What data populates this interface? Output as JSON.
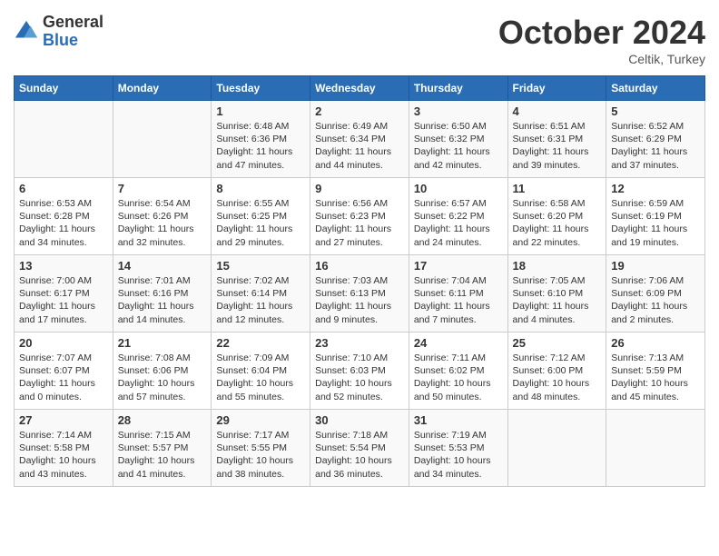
{
  "header": {
    "logo_general": "General",
    "logo_blue": "Blue",
    "month_title": "October 2024",
    "location": "Celtik, Turkey"
  },
  "weekdays": [
    "Sunday",
    "Monday",
    "Tuesday",
    "Wednesday",
    "Thursday",
    "Friday",
    "Saturday"
  ],
  "weeks": [
    [
      null,
      null,
      {
        "day": 1,
        "sunrise": "6:48 AM",
        "sunset": "6:36 PM",
        "daylight": "11 hours and 47 minutes."
      },
      {
        "day": 2,
        "sunrise": "6:49 AM",
        "sunset": "6:34 PM",
        "daylight": "11 hours and 44 minutes."
      },
      {
        "day": 3,
        "sunrise": "6:50 AM",
        "sunset": "6:32 PM",
        "daylight": "11 hours and 42 minutes."
      },
      {
        "day": 4,
        "sunrise": "6:51 AM",
        "sunset": "6:31 PM",
        "daylight": "11 hours and 39 minutes."
      },
      {
        "day": 5,
        "sunrise": "6:52 AM",
        "sunset": "6:29 PM",
        "daylight": "11 hours and 37 minutes."
      }
    ],
    [
      {
        "day": 6,
        "sunrise": "6:53 AM",
        "sunset": "6:28 PM",
        "daylight": "11 hours and 34 minutes."
      },
      {
        "day": 7,
        "sunrise": "6:54 AM",
        "sunset": "6:26 PM",
        "daylight": "11 hours and 32 minutes."
      },
      {
        "day": 8,
        "sunrise": "6:55 AM",
        "sunset": "6:25 PM",
        "daylight": "11 hours and 29 minutes."
      },
      {
        "day": 9,
        "sunrise": "6:56 AM",
        "sunset": "6:23 PM",
        "daylight": "11 hours and 27 minutes."
      },
      {
        "day": 10,
        "sunrise": "6:57 AM",
        "sunset": "6:22 PM",
        "daylight": "11 hours and 24 minutes."
      },
      {
        "day": 11,
        "sunrise": "6:58 AM",
        "sunset": "6:20 PM",
        "daylight": "11 hours and 22 minutes."
      },
      {
        "day": 12,
        "sunrise": "6:59 AM",
        "sunset": "6:19 PM",
        "daylight": "11 hours and 19 minutes."
      }
    ],
    [
      {
        "day": 13,
        "sunrise": "7:00 AM",
        "sunset": "6:17 PM",
        "daylight": "11 hours and 17 minutes."
      },
      {
        "day": 14,
        "sunrise": "7:01 AM",
        "sunset": "6:16 PM",
        "daylight": "11 hours and 14 minutes."
      },
      {
        "day": 15,
        "sunrise": "7:02 AM",
        "sunset": "6:14 PM",
        "daylight": "11 hours and 12 minutes."
      },
      {
        "day": 16,
        "sunrise": "7:03 AM",
        "sunset": "6:13 PM",
        "daylight": "11 hours and 9 minutes."
      },
      {
        "day": 17,
        "sunrise": "7:04 AM",
        "sunset": "6:11 PM",
        "daylight": "11 hours and 7 minutes."
      },
      {
        "day": 18,
        "sunrise": "7:05 AM",
        "sunset": "6:10 PM",
        "daylight": "11 hours and 4 minutes."
      },
      {
        "day": 19,
        "sunrise": "7:06 AM",
        "sunset": "6:09 PM",
        "daylight": "11 hours and 2 minutes."
      }
    ],
    [
      {
        "day": 20,
        "sunrise": "7:07 AM",
        "sunset": "6:07 PM",
        "daylight": "11 hours and 0 minutes."
      },
      {
        "day": 21,
        "sunrise": "7:08 AM",
        "sunset": "6:06 PM",
        "daylight": "10 hours and 57 minutes."
      },
      {
        "day": 22,
        "sunrise": "7:09 AM",
        "sunset": "6:04 PM",
        "daylight": "10 hours and 55 minutes."
      },
      {
        "day": 23,
        "sunrise": "7:10 AM",
        "sunset": "6:03 PM",
        "daylight": "10 hours and 52 minutes."
      },
      {
        "day": 24,
        "sunrise": "7:11 AM",
        "sunset": "6:02 PM",
        "daylight": "10 hours and 50 minutes."
      },
      {
        "day": 25,
        "sunrise": "7:12 AM",
        "sunset": "6:00 PM",
        "daylight": "10 hours and 48 minutes."
      },
      {
        "day": 26,
        "sunrise": "7:13 AM",
        "sunset": "5:59 PM",
        "daylight": "10 hours and 45 minutes."
      }
    ],
    [
      {
        "day": 27,
        "sunrise": "7:14 AM",
        "sunset": "5:58 PM",
        "daylight": "10 hours and 43 minutes."
      },
      {
        "day": 28,
        "sunrise": "7:15 AM",
        "sunset": "5:57 PM",
        "daylight": "10 hours and 41 minutes."
      },
      {
        "day": 29,
        "sunrise": "7:17 AM",
        "sunset": "5:55 PM",
        "daylight": "10 hours and 38 minutes."
      },
      {
        "day": 30,
        "sunrise": "7:18 AM",
        "sunset": "5:54 PM",
        "daylight": "10 hours and 36 minutes."
      },
      {
        "day": 31,
        "sunrise": "7:19 AM",
        "sunset": "5:53 PM",
        "daylight": "10 hours and 34 minutes."
      },
      null,
      null
    ]
  ],
  "labels": {
    "sunrise_prefix": "Sunrise: ",
    "sunset_prefix": "Sunset: ",
    "daylight_prefix": "Daylight: "
  }
}
